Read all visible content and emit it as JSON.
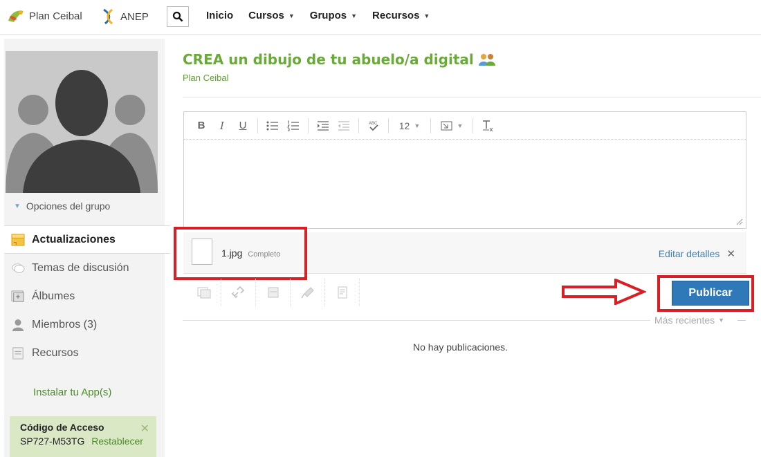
{
  "header": {
    "brand_ceibal": "Plan Ceibal",
    "brand_anep": "ANEP",
    "nav": [
      {
        "label": "Inicio",
        "dropdown": false
      },
      {
        "label": "Cursos",
        "dropdown": true
      },
      {
        "label": "Grupos",
        "dropdown": true
      },
      {
        "label": "Recursos",
        "dropdown": true
      }
    ]
  },
  "sidebar": {
    "group_options": "Opciones del grupo",
    "items": [
      {
        "label": "Actualizaciones",
        "icon": "updates-icon",
        "active": true
      },
      {
        "label": "Temas de discusión",
        "icon": "discussion-icon",
        "active": false
      },
      {
        "label": "Álbumes",
        "icon": "albums-icon",
        "active": false
      },
      {
        "label": "Miembros (3)",
        "icon": "members-icon",
        "active": false
      },
      {
        "label": "Recursos",
        "icon": "resources-icon",
        "active": false
      }
    ],
    "install_link": "Instalar tu App(s)",
    "access": {
      "title": "Código de Acceso",
      "code": "SP727-M53TG",
      "reset": "Restablecer"
    }
  },
  "main": {
    "title": "CREA un dibujo de tu abuelo/a digital",
    "subtitle": "Plan Ceibal",
    "editor": {
      "font_size": "12"
    },
    "attachment": {
      "file_name": "1.jpg",
      "status": "Completo",
      "edit_details": "Editar detalles"
    },
    "publish_label": "Publicar",
    "sort_label": "Más recientes",
    "empty_message": "No hay publicaciones."
  },
  "colors": {
    "accent_green": "#6aaa3a",
    "publish_blue": "#2f79b9",
    "highlight_red": "#d81f26",
    "access_bg": "#dbe8c6"
  }
}
